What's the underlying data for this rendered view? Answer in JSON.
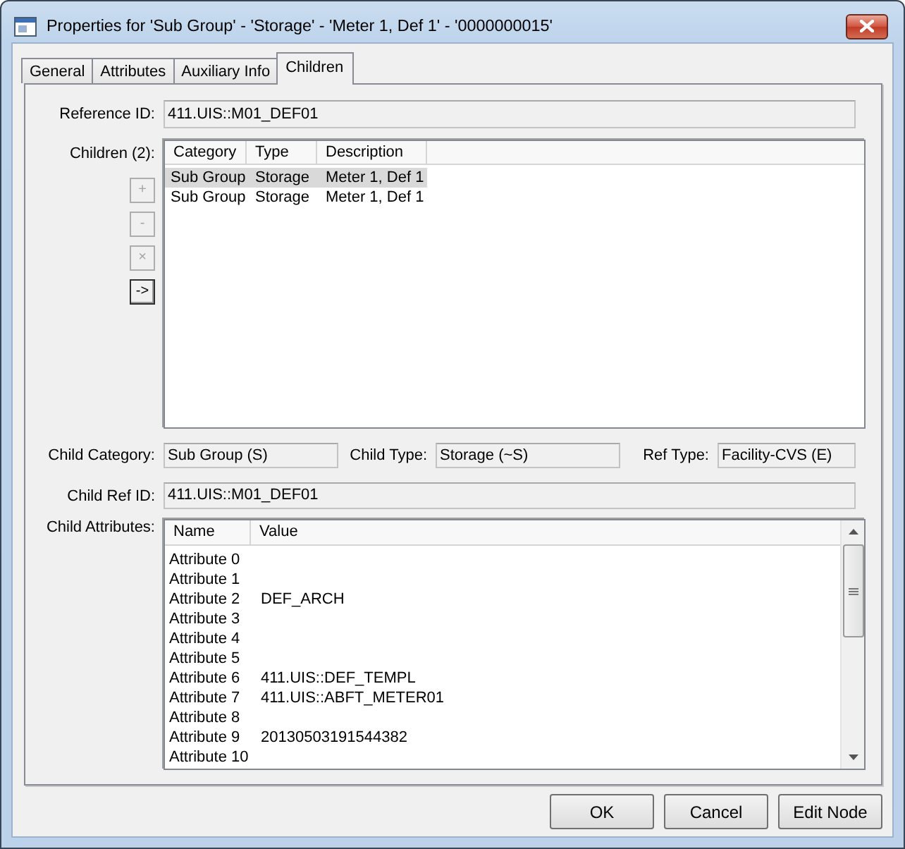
{
  "window": {
    "title": "Properties for 'Sub Group' - 'Storage' - 'Meter 1, Def 1' - '0000000015'"
  },
  "tabs": [
    {
      "label": "General",
      "selected": false
    },
    {
      "label": "Attributes",
      "selected": false
    },
    {
      "label": "Auxiliary Info",
      "selected": false
    },
    {
      "label": "Children",
      "selected": true
    }
  ],
  "reference_id": {
    "label": "Reference ID:",
    "value": "411.UIS::M01_DEF01"
  },
  "children": {
    "label": "Children (2):",
    "buttons": [
      {
        "label": "+",
        "disabled": true
      },
      {
        "label": "-",
        "disabled": true
      },
      {
        "label": "×",
        "disabled": true
      },
      {
        "label": "->",
        "disabled": false
      }
    ],
    "columns": [
      "Category",
      "Type",
      "Description"
    ],
    "rows": [
      {
        "cells": [
          "Sub Group",
          "Storage",
          "Meter 1, Def 1"
        ],
        "selected": true
      },
      {
        "cells": [
          "Sub Group",
          "Storage",
          "Meter 1, Def 1"
        ],
        "selected": false
      }
    ]
  },
  "child_fields": [
    {
      "label": "Child Category:",
      "value": "Sub Group (S)"
    },
    {
      "label": "Child Type:",
      "value": "Storage (~S)"
    },
    {
      "label": "Ref Type:",
      "value": "Facility-CVS (E)"
    }
  ],
  "child_ref_id": {
    "label": "Child Ref ID:",
    "value": "411.UIS::M01_DEF01"
  },
  "child_attributes": {
    "label": "Child Attributes:",
    "columns": [
      "Name",
      "Value"
    ],
    "rows": [
      {
        "name": "Attribute 0",
        "selected": false
      },
      {
        "name": "Attribute 1",
        "selected": false
      },
      {
        "name": "Attribute 2",
        "value": "DEF_ARCH",
        "selected": false
      },
      {
        "name": "Attribute 3",
        "selected": false
      },
      {
        "name": "Attribute 4",
        "selected": false
      },
      {
        "name": "Attribute 5",
        "selected": false
      },
      {
        "name": "Attribute 6",
        "value": "411.UIS::DEF_TEMPL",
        "selected": false
      },
      {
        "name": "Attribute 7",
        "value": "411.UIS::ABFT_METER01",
        "selected": false
      },
      {
        "name": "Attribute 8",
        "selected": false
      },
      {
        "name": "Attribute 9",
        "value": "20130503191544382",
        "selected": false
      },
      {
        "name": "Attribute 10",
        "selected": false
      }
    ]
  },
  "buttons": [
    {
      "label": "OK"
    },
    {
      "label": "Cancel"
    },
    {
      "label": "Edit Node"
    }
  ]
}
